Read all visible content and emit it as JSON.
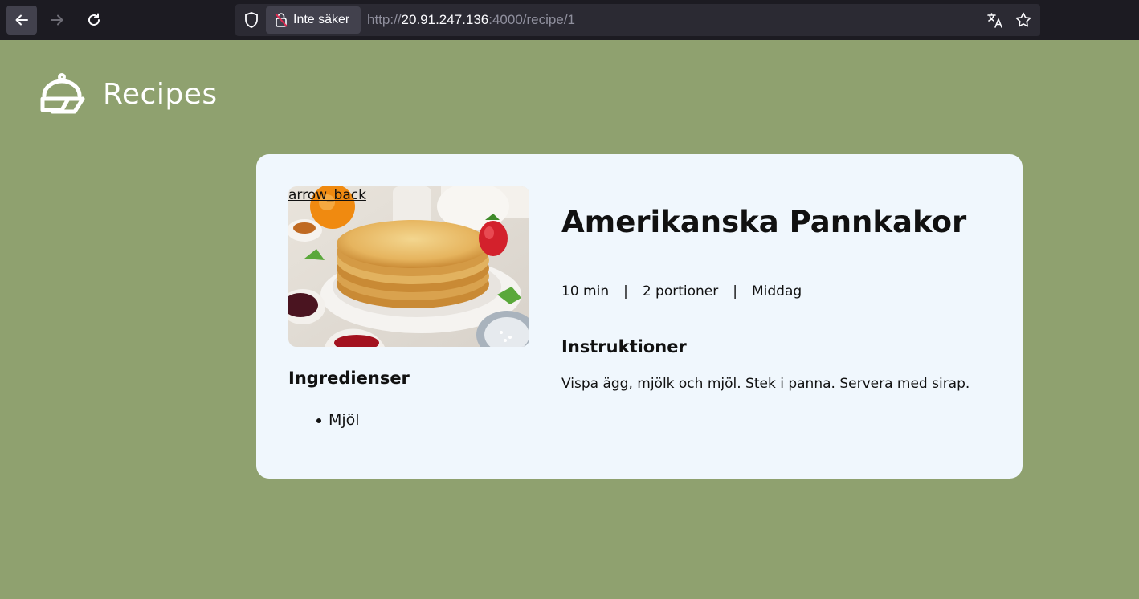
{
  "browser": {
    "security_label": "Inte säker",
    "url_prefix": "http://",
    "url_host": "20.91.247.136",
    "url_rest": ":4000/recipe/1"
  },
  "site": {
    "title": "Recipes"
  },
  "recipe": {
    "back_label": "arrow_back",
    "title": "Amerikanska Pannkakor",
    "time": "10 min",
    "portions": "2 portioner",
    "category": "Middag",
    "separator": "|",
    "ingredients_heading": "Ingredienser",
    "ingredients": [
      "Mjöl"
    ],
    "instructions_heading": "Instruktioner",
    "instructions": "Vispa ägg, mjölk och mjöl. Stek i panna. Servera med sirap."
  },
  "colors": {
    "page_background": "#8fa16f",
    "card_background": "#f0f7fd",
    "browser_chrome": "#1c1b22"
  }
}
